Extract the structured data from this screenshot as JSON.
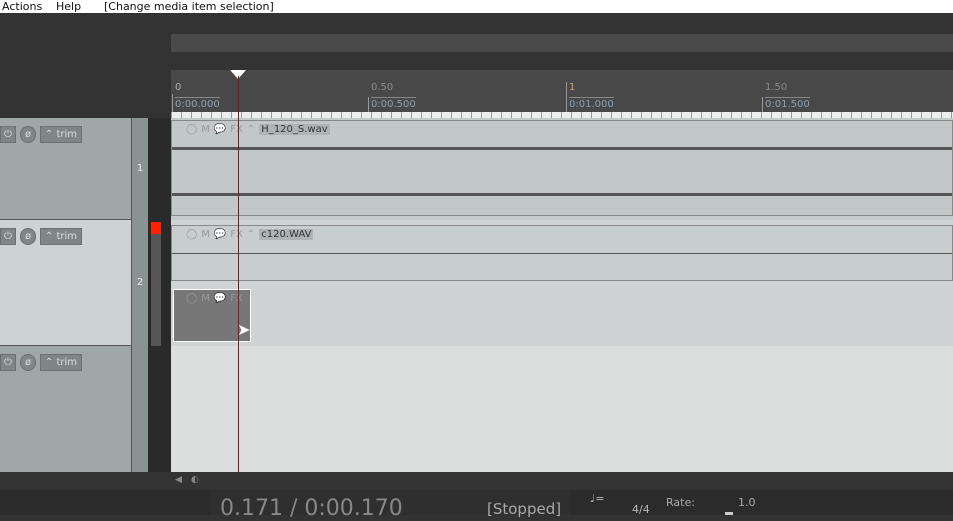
{
  "menu": {
    "items": [
      "Actions",
      "Help"
    ],
    "status": "[Change media item selection]"
  },
  "ruler": {
    "marks": [
      {
        "beat": "0",
        "time": "0:00.000"
      },
      {
        "beat": "0.50",
        "time": "0:00.500"
      },
      {
        "beat": "1",
        "time": "0:01.000"
      },
      {
        "beat": "1.50",
        "time": "0:01.500"
      }
    ]
  },
  "tracks": [
    {
      "number": "1",
      "trim": "trim"
    },
    {
      "number": "2",
      "trim": "trim"
    },
    {
      "number": "",
      "trim": "trim"
    }
  ],
  "items": [
    {
      "name": "H_120_S.wav",
      "mute": "M",
      "fx": "FX"
    },
    {
      "name": "c120.WAV",
      "mute": "M",
      "fx": "FX"
    },
    {
      "name": "",
      "mute": "M",
      "fx": "FX"
    }
  ],
  "transport": {
    "position": "0.171 / 0:00.170",
    "state": "[Stopped]",
    "metronome": "♩=",
    "timesig": "4/4",
    "rate_label": "Rate:",
    "rate_value": "1.0"
  },
  "colors": {
    "cursor": "#7a1c1c",
    "meter_clip": "#ff2200"
  }
}
